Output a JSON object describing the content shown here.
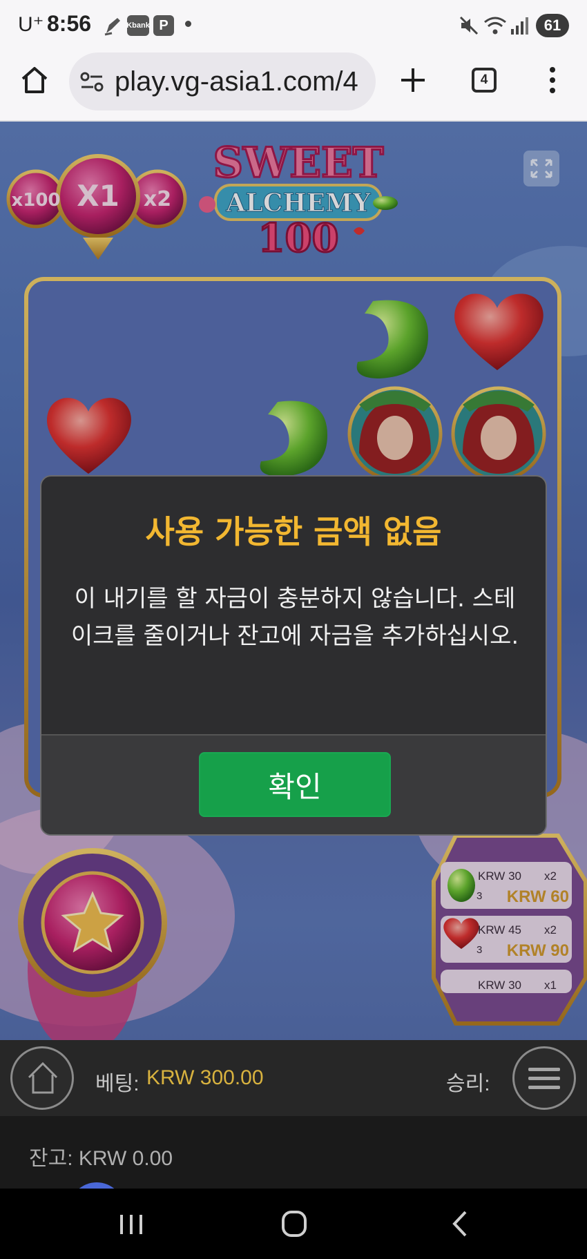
{
  "status_bar": {
    "carrier": "U⁺",
    "time": "8:56",
    "app_badge_1": "Kbank",
    "app_badge_2": "P",
    "battery": "61"
  },
  "browser": {
    "url": "play.vg-asia1.com/4",
    "tab_count": "4"
  },
  "game": {
    "logo_line1": "SWEET",
    "logo_line2": "ALCHEMY",
    "logo_line3": "100",
    "multipliers": [
      "x100",
      "X1",
      "x2"
    ],
    "paytable": [
      {
        "label": "KRW 30",
        "mult": "x2",
        "win": "KRW 60",
        "count": "3"
      },
      {
        "label": "KRW 45",
        "mult": "x2",
        "win": "KRW 90",
        "count": "3"
      },
      {
        "label": "KRW 30",
        "mult": "x1"
      }
    ]
  },
  "modal": {
    "title": "사용 가능한 금액 없음",
    "message": "이 내기를 할 자금이 충분하지 않습니다. 스테이크를 줄이거나 잔고에 자금을 추가하십시오.",
    "confirm_label": "확인"
  },
  "bottom_bar": {
    "bet_label": "베팅:",
    "bet_value": "KRW 300.00",
    "win_label": "승리:",
    "balance": "잔고: KRW 0.00"
  },
  "colors": {
    "modal_title": "#f2b731",
    "confirm_button": "#16a04a",
    "bet_value": "#d8b23f"
  }
}
